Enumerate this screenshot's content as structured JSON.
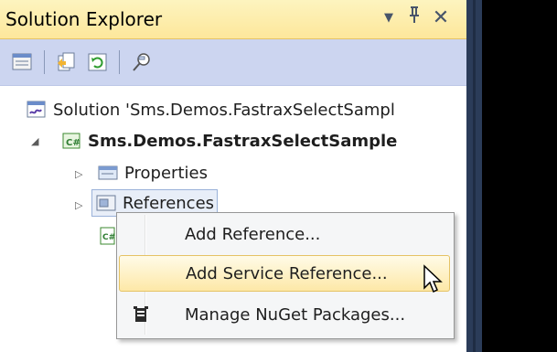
{
  "panel": {
    "title": "Solution Explorer",
    "buttons": {
      "dropdown": "▼",
      "pin": "ᐰ",
      "close": "✕"
    }
  },
  "toolbar": {
    "icons": [
      "properties-icon",
      "show-all-files-icon",
      "refresh-icon",
      "view-class-diagram-icon"
    ]
  },
  "tree": {
    "solution": "Solution 'Sms.Demos.FastraxSelectSampl",
    "project": "Sms.Demos.FastraxSelectSample",
    "properties": "Properties",
    "references": "References"
  },
  "context_menu": {
    "items": [
      {
        "label": "Add Reference..."
      },
      {
        "label": "Add Service Reference...",
        "highlighted": true
      },
      {
        "label": "Manage NuGet Packages...",
        "icon": "nuget-icon"
      }
    ]
  },
  "colors": {
    "titlebar": "#fde79b",
    "toolbar": "#ccd5f0",
    "highlight": "#fde8a7",
    "side_dark": "#2b3c59"
  }
}
